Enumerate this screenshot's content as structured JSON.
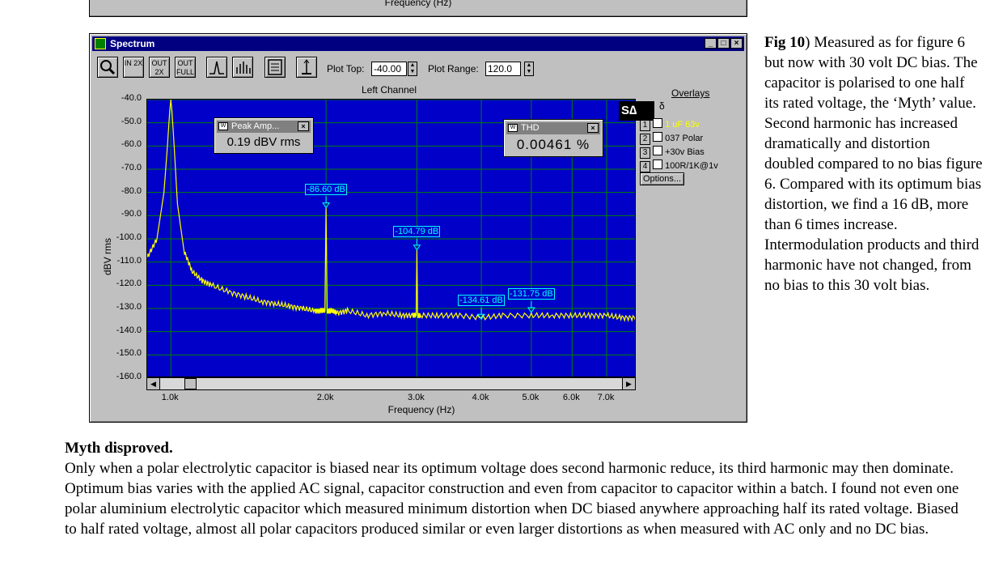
{
  "previous_figure": {
    "x_axis_label": "Frequency (Hz)"
  },
  "window": {
    "title": "Spectrum",
    "toolbar": {
      "buttons": [
        "zoom-icon",
        "zoom-in-2x",
        "zoom-out-2x",
        "zoom-out-full",
        "line-mode",
        "bar-mode",
        "properties",
        "scale"
      ],
      "zoom_in_label": "IN 2X",
      "zoom_out_label": "OUT 2X",
      "zoom_full_label": "OUT FULL",
      "plot_top_label": "Plot Top:",
      "plot_top_value": "-40.00",
      "plot_range_label": "Plot Range:",
      "plot_range_value": "120.0"
    },
    "plot_title": "Left Channel",
    "overlays": {
      "title": "Overlays",
      "items": [
        {
          "num": "1",
          "label": "1 uF 63v",
          "color": "#ffff00"
        },
        {
          "num": "2",
          "label": "037 Polar",
          "color": "#000000"
        },
        {
          "num": "3",
          "label": "+30v Bias",
          "color": "#000000"
        },
        {
          "num": "4",
          "label": "100R/1K@1v",
          "color": "#000000"
        }
      ],
      "options_label": "Options..."
    },
    "peak_box": {
      "title": "Peak Amp...",
      "value": "0.19 dBV rms"
    },
    "thd_box": {
      "title": "THD",
      "value": "0.00461 %"
    },
    "colors": {
      "plot_bg": "#0000c8",
      "grid": "#008000",
      "trace": "#ffff00",
      "marker": "#00ffff",
      "titlebar": "#000080"
    }
  },
  "chart_data": {
    "type": "line",
    "title": "Left Channel",
    "xlabel": "Frequency (Hz)",
    "ylabel": "dBV rms",
    "x_scale": "log",
    "xlim": [
      900,
      8000
    ],
    "ylim": [
      -160,
      -40
    ],
    "x_ticks": [
      "1.0k",
      "2.0k",
      "3.0k",
      "4.0k",
      "5.0k",
      "6.0k",
      "7.0k"
    ],
    "y_ticks": [
      "-40.0",
      "-50.0",
      "-60.0",
      "-70.0",
      "-80.0",
      "-90.0",
      "-100.0",
      "-110.0",
      "-120.0",
      "-130.0",
      "-140.0",
      "-150.0",
      "-160.0"
    ],
    "grid": true,
    "series": [
      {
        "name": "1 uF 63v",
        "x": [
          900,
          940,
          970,
          985,
          995,
          1000,
          1005,
          1015,
          1030,
          1060,
          1100,
          1150,
          1200,
          1300,
          1400,
          1500,
          1600,
          1700,
          1800,
          1900,
          1950,
          1990,
          2000,
          2010,
          2050,
          2100,
          2200,
          2400,
          2600,
          2800,
          2950,
          2990,
          3000,
          3010,
          3050,
          3300,
          3600,
          4000,
          4400,
          5000,
          5500,
          6000,
          6500,
          7000,
          7500,
          8000
        ],
        "y": [
          -108,
          -100,
          -80,
          -60,
          -45,
          -40,
          -45,
          -60,
          -85,
          -105,
          -114,
          -118,
          -120,
          -123,
          -125,
          -127,
          -128,
          -129,
          -130,
          -131,
          -131,
          -131,
          -86.6,
          -131,
          -131,
          -132,
          -131,
          -133,
          -132,
          -133,
          -133,
          -133,
          -104.8,
          -133,
          -133,
          -133,
          -133,
          -134,
          -133,
          -133,
          -133,
          -133,
          -133,
          -133,
          -134,
          -134
        ]
      }
    ],
    "annotations": [
      {
        "x": 2000,
        "y": -86.6,
        "text": "-86.60 dB"
      },
      {
        "x": 3000,
        "y": -104.79,
        "text": "-104.79 dB"
      },
      {
        "x": 4000,
        "y": -134.61,
        "text": "-134.61 dB"
      },
      {
        "x": 5000,
        "y": -131.75,
        "text": "-131.75 dB"
      }
    ]
  },
  "caption": {
    "fig_label": "Fig 10",
    "text": ") Measured as for figure 6 but now with 30 volt DC bias. The capacitor is polarised to one half its rated voltage, the ‘Myth’ value. Second harmonic has increased dramatically and distortion doubled compared to no bias figure 6. Compared with its optimum bias distortion, we find a 16 dB, more than 6 times increase. Intermodulation products and third harmonic have not changed, from no bias to this 30 volt bias."
  },
  "section": {
    "heading": "Myth disproved.",
    "paragraph": "Only when a polar electrolytic capacitor is biased near its optimum voltage does second harmonic reduce, its third harmonic may then dominate. Optimum bias varies with the applied AC signal, capacitor construction and even from capacitor to capacitor within a batch. I found not even one polar aluminium electrolytic capacitor which measured minimum distortion when DC biased anywhere approaching half its rated voltage. Biased to half rated voltage, almost all polar capacitors produced similar or even larger distortions as when measured with AC only and no DC bias."
  }
}
